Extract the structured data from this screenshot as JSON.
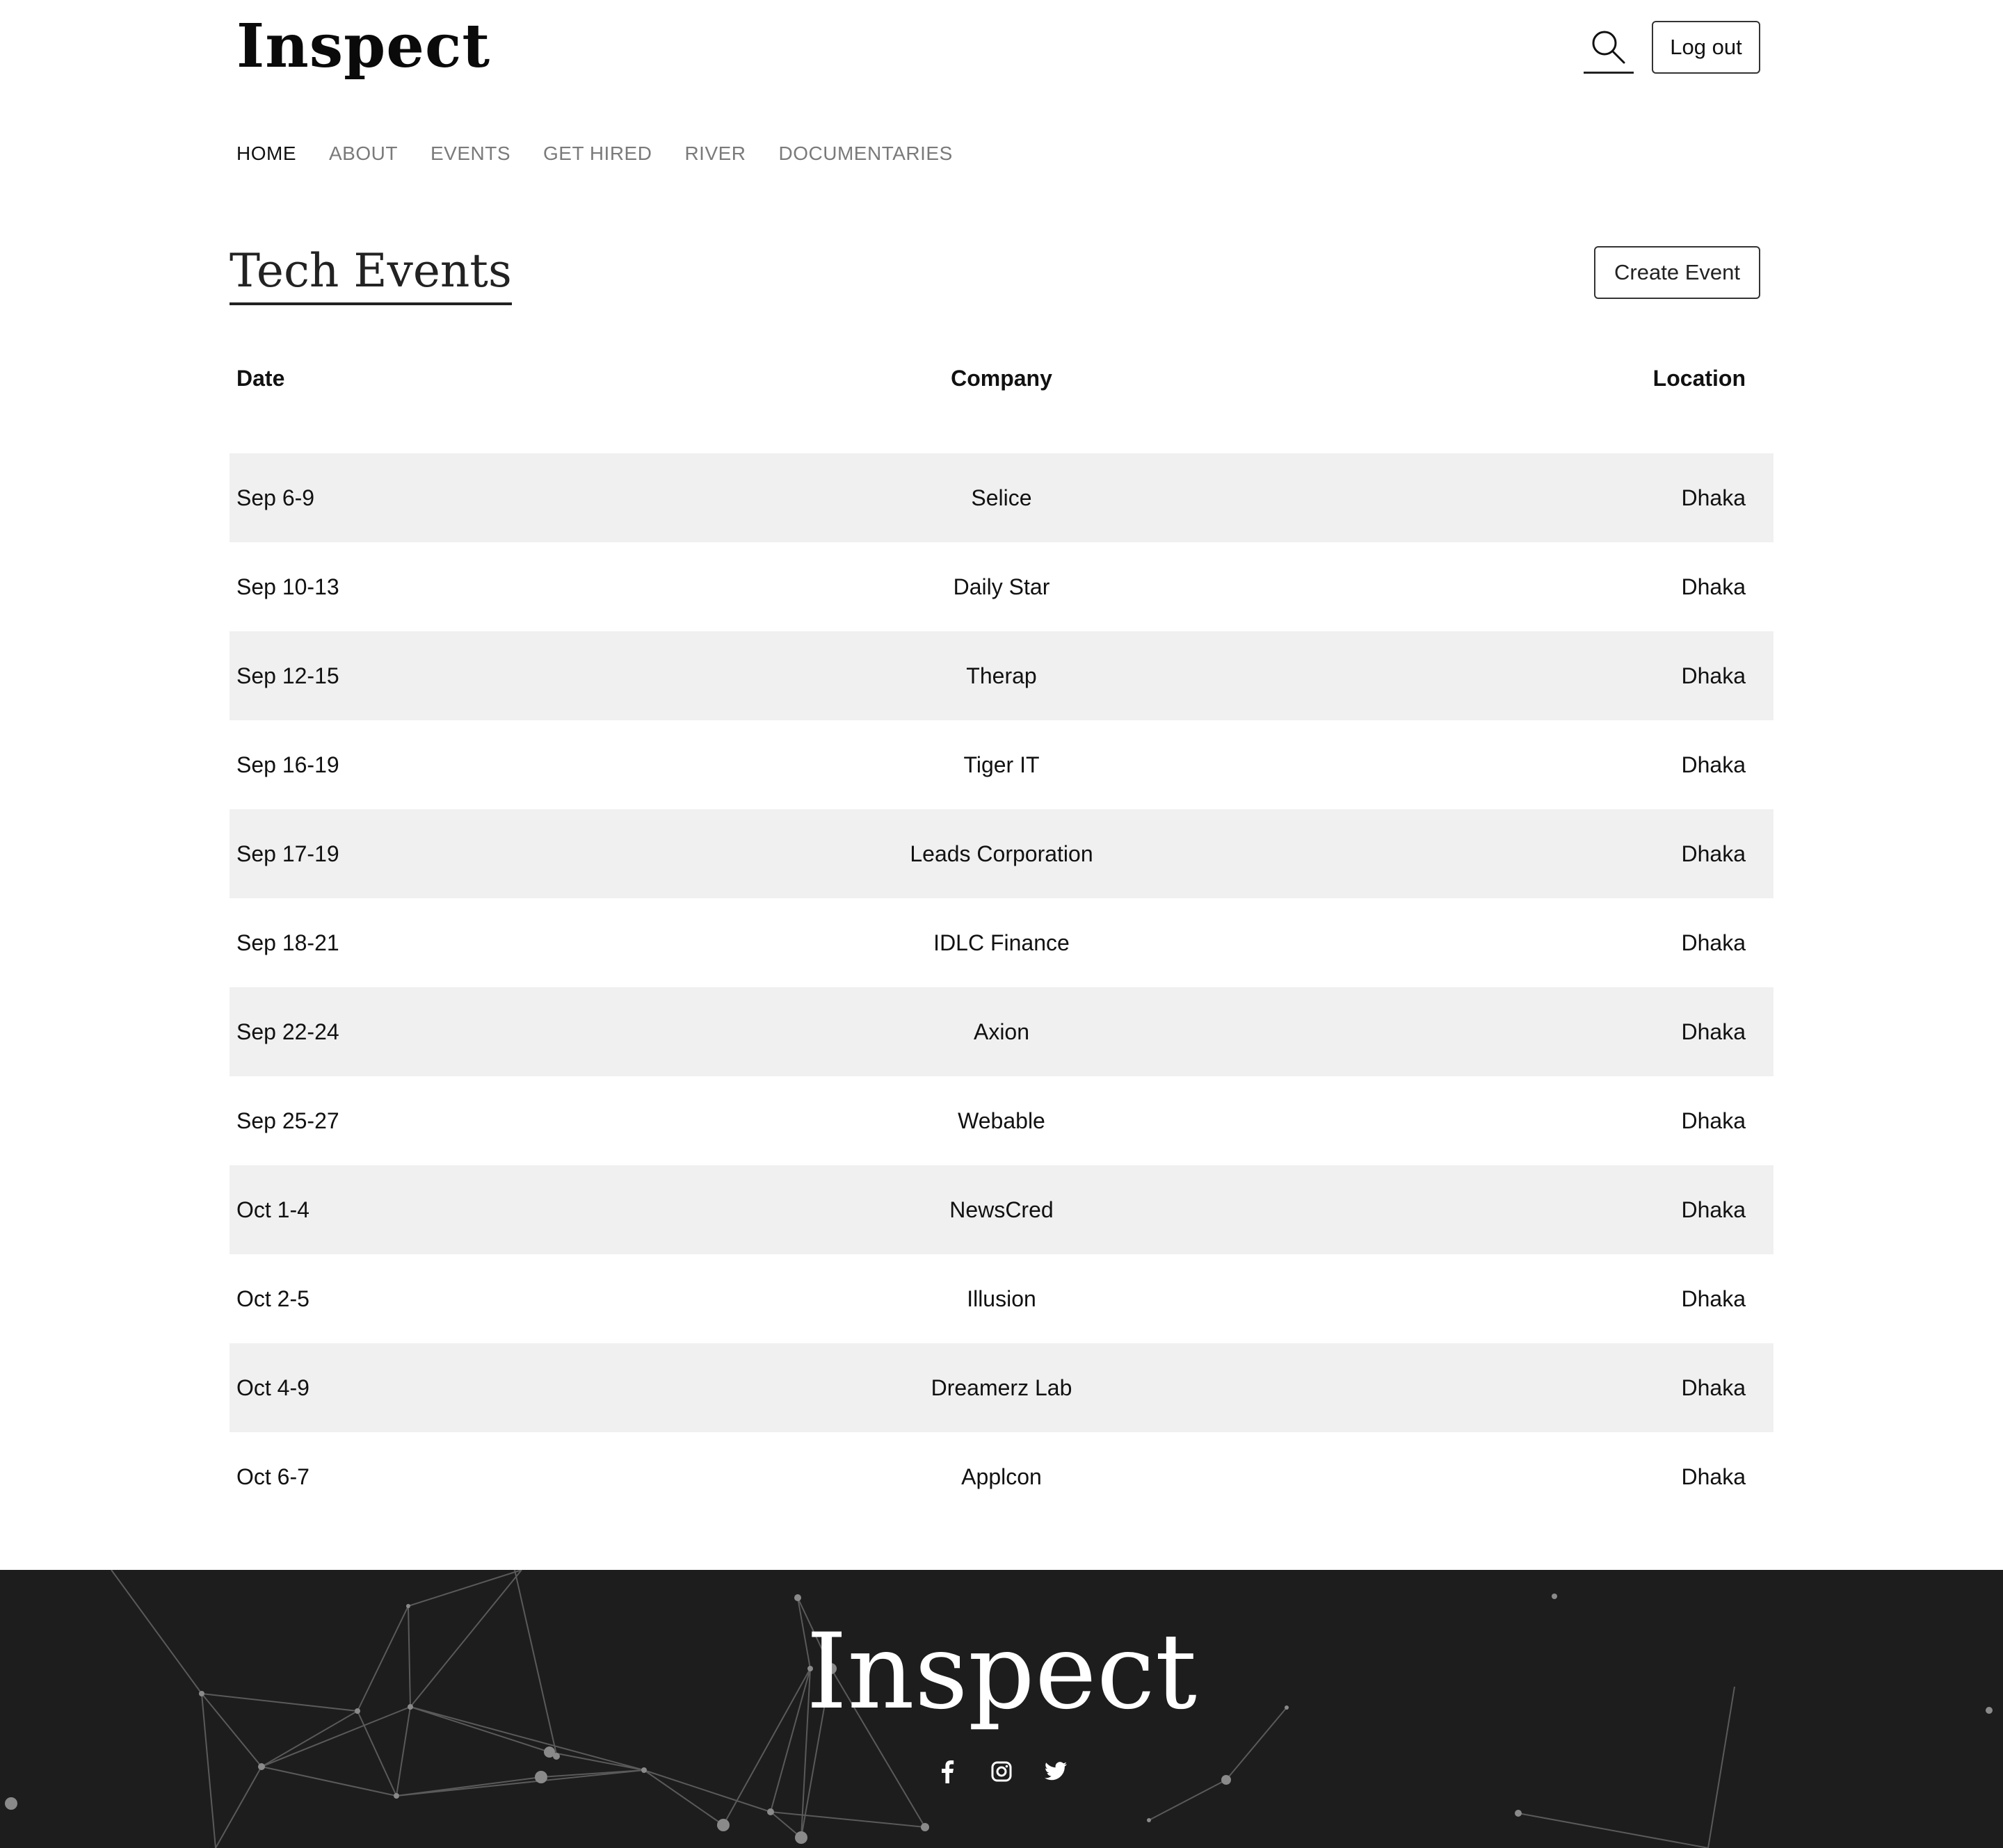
{
  "header": {
    "logo": "Inspect",
    "search_icon": "search-icon",
    "logout_label": "Log out"
  },
  "nav": {
    "items": [
      {
        "label": "HOME",
        "active": true
      },
      {
        "label": "ABOUT",
        "active": false
      },
      {
        "label": "EVENTS",
        "active": false
      },
      {
        "label": "GET HIRED",
        "active": false
      },
      {
        "label": "RIVER",
        "active": false
      },
      {
        "label": "DOCUMENTARIES",
        "active": false
      }
    ]
  },
  "main": {
    "title": "Tech Events",
    "create_label": "Create Event",
    "table": {
      "columns": [
        "Date",
        "Company",
        "Location"
      ],
      "rows": [
        [
          "Sep 6-9",
          "Selice",
          "Dhaka"
        ],
        [
          "Sep 10-13",
          "Daily Star",
          "Dhaka"
        ],
        [
          "Sep 12-15",
          "Therap",
          "Dhaka"
        ],
        [
          "Sep 16-19",
          "Tiger IT",
          "Dhaka"
        ],
        [
          "Sep 17-19",
          "Leads Corporation",
          "Dhaka"
        ],
        [
          "Sep 18-21",
          "IDLC Finance",
          "Dhaka"
        ],
        [
          "Sep 22-24",
          "Axion",
          "Dhaka"
        ],
        [
          "Sep 25-27",
          "Webable",
          "Dhaka"
        ],
        [
          "Oct 1-4",
          "NewsCred",
          "Dhaka"
        ],
        [
          "Oct 2-5",
          "Illusion",
          "Dhaka"
        ],
        [
          "Oct 4-9",
          "Dreamerz Lab",
          "Dhaka"
        ],
        [
          "Oct 6-7",
          "Applcon",
          "Dhaka"
        ]
      ]
    }
  },
  "footer": {
    "logo": "Inspect",
    "social_icons": [
      "facebook-icon",
      "instagram-icon",
      "twitter-icon"
    ],
    "background_color": "#1d1d1d"
  }
}
